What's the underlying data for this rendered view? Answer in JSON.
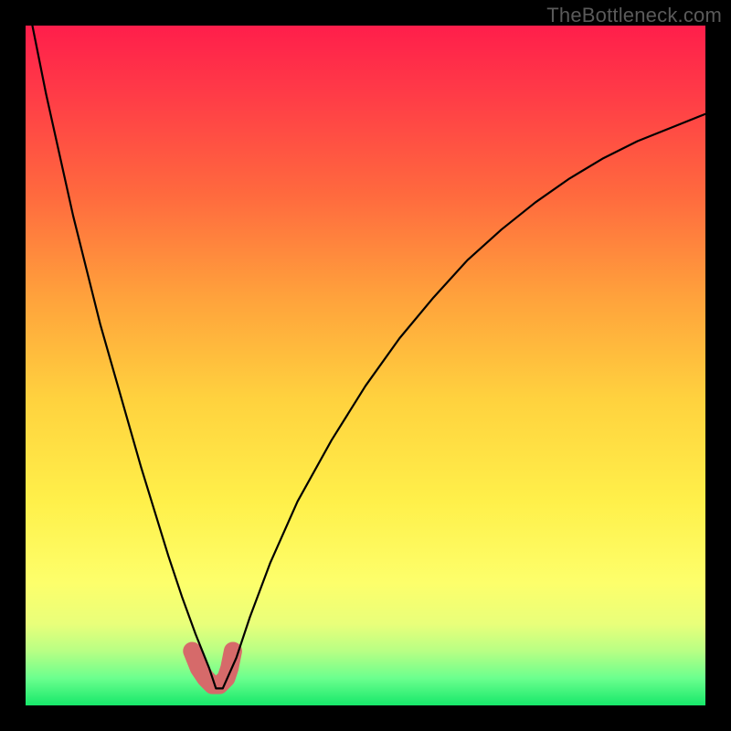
{
  "watermark": "TheBottleneck.com",
  "chart_data": {
    "type": "line",
    "title": "",
    "xlabel": "",
    "ylabel": "",
    "xlim": [
      0,
      100
    ],
    "ylim": [
      0,
      100
    ],
    "series": [
      {
        "name": "bottleneck-curve",
        "x": [
          1,
          3,
          5,
          7,
          9,
          11,
          13,
          15,
          17,
          19,
          21,
          23,
          25,
          27,
          28,
          29,
          31,
          33,
          36,
          40,
          45,
          50,
          55,
          60,
          65,
          70,
          75,
          80,
          85,
          90,
          95,
          100
        ],
        "values": [
          100,
          90,
          81,
          72,
          64,
          56,
          49,
          42,
          35,
          28.5,
          22,
          16,
          10.5,
          5.5,
          2.5,
          2.5,
          7,
          13,
          21,
          30,
          39,
          47,
          54,
          60,
          65.5,
          70,
          74,
          77.5,
          80.5,
          83,
          85,
          87
        ]
      },
      {
        "name": "optimal-marker",
        "x": [
          24.5,
          25.5,
          26.5,
          27.5,
          28.5,
          29.5,
          30.0,
          30.5
        ],
        "values": [
          8,
          5.5,
          4,
          3,
          3,
          4,
          5.5,
          8
        ]
      }
    ],
    "colors": {
      "curve": "#000000",
      "marker": "#d66a6a"
    },
    "annotations": []
  }
}
